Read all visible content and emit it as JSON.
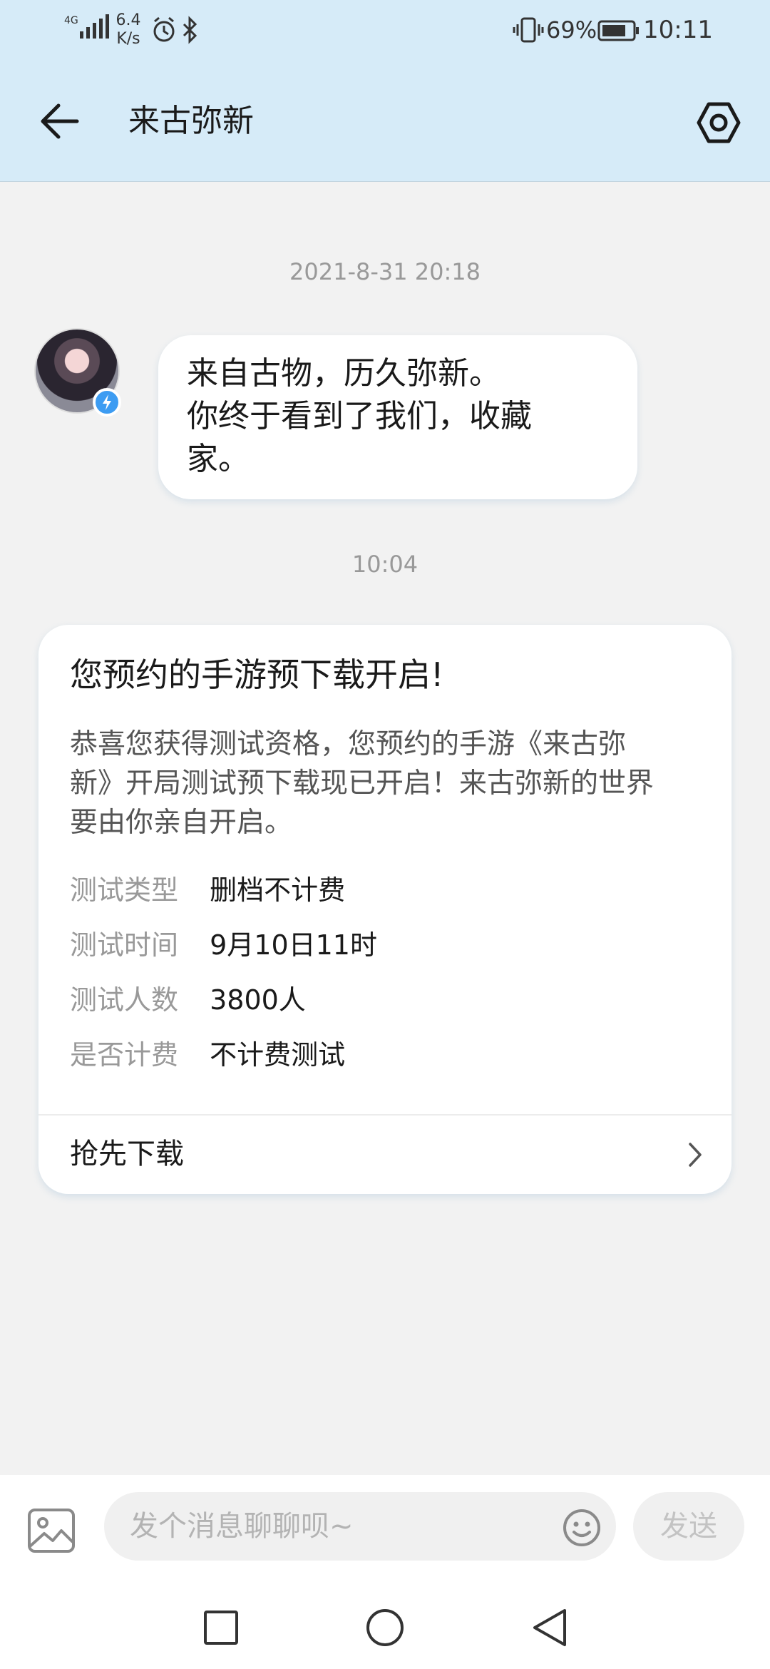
{
  "status_bar": {
    "network": "4G",
    "speed_value": "6.4",
    "speed_unit": "K/s",
    "battery_percent": "69%",
    "time": "10:11"
  },
  "header": {
    "title": "来古弥新"
  },
  "messages": [
    {
      "timestamp": "2021-8-31 20:18",
      "lines": [
        "来自古物，历久弥新。",
        "你终于看到了我们，收藏",
        "家。"
      ]
    },
    {
      "timestamp": "10:04",
      "card": {
        "title": "您预约的手游预下载开启!",
        "body_lines": [
          "恭喜您获得测试资格，您预约的手游《来古弥",
          "新》开局测试预下载现已开启！来古弥新的世界",
          "要由你亲自开启。"
        ],
        "info_rows": [
          {
            "label": "测试类型",
            "value": "删档不计费"
          },
          {
            "label": "测试时间",
            "value": "9月10日11时"
          },
          {
            "label": "测试人数",
            "value": "3800人"
          },
          {
            "label": "是否计费",
            "value": "不计费测试"
          }
        ],
        "action_label": "抢先下载"
      }
    }
  ],
  "input_bar": {
    "placeholder": "发个消息聊聊呗~",
    "value": "",
    "send_label": "发送"
  },
  "icons": {
    "back": "arrow-left-icon",
    "settings": "hexagon-gear-icon",
    "image": "image-icon",
    "emoji": "smiley-icon",
    "chevron": "chevron-right-icon"
  },
  "colors": {
    "header_bg": "#d6ebf8",
    "page_bg": "#f2f2f2",
    "verified_badge": "#3d9cf2"
  }
}
